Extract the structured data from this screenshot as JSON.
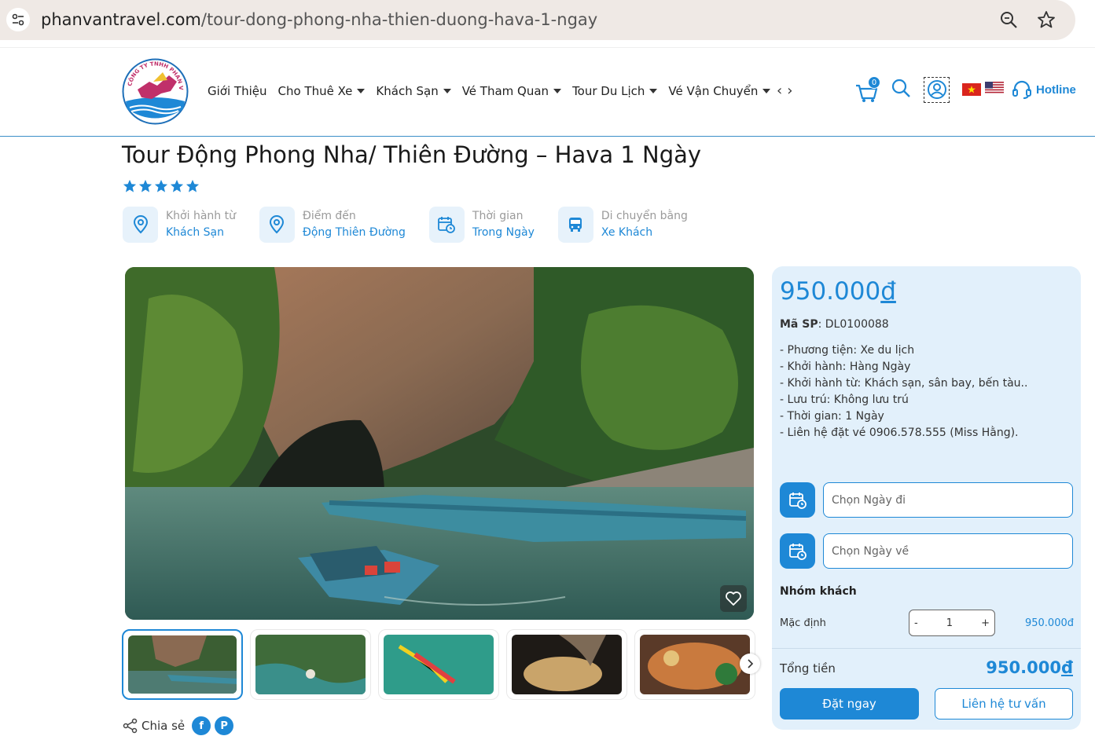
{
  "browser": {
    "url_host": "phanvantravel.com",
    "url_path": "/tour-dong-phong-nha-thien-duong-hava-1-ngay"
  },
  "header": {
    "logo_text": "CÔNG TY TNHH PHAN VÂN",
    "nav": [
      {
        "label": "Giới Thiệu",
        "dropdown": false
      },
      {
        "label": "Cho Thuê Xe",
        "dropdown": true
      },
      {
        "label": "Khách Sạn",
        "dropdown": true
      },
      {
        "label": "Vé Tham Quan",
        "dropdown": true
      },
      {
        "label": "Tour Du Lịch",
        "dropdown": true
      },
      {
        "label": "Vé Vận Chuyển",
        "dropdown": true
      }
    ],
    "cart_count": "0",
    "hotline_label": "Hotline"
  },
  "product": {
    "title": "Tour Động Phong Nha/ Thiên Đường – Hava 1 Ngày",
    "rating_stars": 5,
    "info": [
      {
        "icon": "location-pin-icon",
        "label": "Khởi hành từ",
        "value": "Khách Sạn"
      },
      {
        "icon": "location-pin-icon",
        "label": "Điểm đến",
        "value": "Động Thiên Đường"
      },
      {
        "icon": "calendar-clock-icon",
        "label": "Thời gian",
        "value": "Trong Ngày"
      },
      {
        "icon": "bus-icon",
        "label": "Di chuyển bằng",
        "value": "Xe Khách"
      }
    ],
    "share_label": "Chia sẻ"
  },
  "booking": {
    "price": "950.000",
    "currency": "đ",
    "sku_label": "Mã SP",
    "sku_value": ": DL0100088",
    "details": [
      "- Phương tiện: Xe du lịch",
      "- Khởi hành: Hàng Ngày",
      "- Khởi hành từ: Khách sạn, sân bay, bến tàu..",
      "- Lưu trú: Không lưu trú",
      "- Thời gian: 1 Ngày",
      "- Liên hệ đặt vé 0906.578.555 (Miss Hằng)."
    ],
    "date_from_placeholder": "Chọn Ngày đi",
    "date_to_placeholder": "Chọn Ngày về",
    "group_title": "Nhóm khách",
    "group_label": "Mặc định",
    "quantity": "1",
    "minus": "-",
    "plus": "+",
    "group_price": "950.000đ",
    "total_label": "Tổng tiền",
    "total_value": "950.000",
    "book_label": "Đặt ngay",
    "contact_label": "Liên hệ tư vấn"
  },
  "colors": {
    "accent": "#1e88d6",
    "panel_bg": "#e2f0fb"
  }
}
